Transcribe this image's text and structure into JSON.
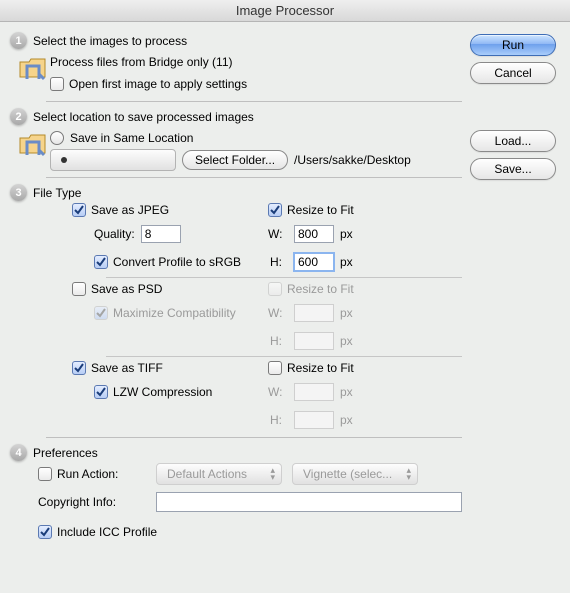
{
  "window": {
    "title": "Image Processor"
  },
  "buttons": {
    "run": "Run",
    "cancel": "Cancel",
    "load": "Load...",
    "save": "Save..."
  },
  "section1": {
    "num": "1",
    "title": "Select the images to process",
    "bridge_line": "Process files from Bridge only (11)",
    "open_first": {
      "checked": false,
      "label": "Open first image to apply settings"
    }
  },
  "section2": {
    "num": "2",
    "title": "Select location to save processed images",
    "same_location": {
      "selected": false,
      "label": "Save in Same Location"
    },
    "select_folder": {
      "selected": true,
      "button": "Select Folder...",
      "path": "/Users/sakke/Desktop"
    }
  },
  "section3": {
    "num": "3",
    "title": "File Type",
    "jpeg": {
      "save": {
        "checked": true,
        "label": "Save as JPEG"
      },
      "quality_label": "Quality:",
      "quality_value": "8",
      "convert": {
        "checked": true,
        "label": "Convert Profile to sRGB"
      },
      "resize": {
        "checked": true,
        "label": "Resize to Fit"
      },
      "w_label": "W:",
      "w_value": "800",
      "h_label": "H:",
      "h_value": "600",
      "px": "px"
    },
    "psd": {
      "save": {
        "checked": false,
        "label": "Save as PSD"
      },
      "max": {
        "checked": true,
        "label": "Maximize Compatibility"
      },
      "resize": {
        "checked": false,
        "label": "Resize to Fit"
      },
      "w_label": "W:",
      "w_value": "",
      "h_label": "H:",
      "h_value": "",
      "px": "px"
    },
    "tiff": {
      "save": {
        "checked": true,
        "label": "Save as TIFF"
      },
      "lzw": {
        "checked": true,
        "label": "LZW Compression"
      },
      "resize": {
        "checked": false,
        "label": "Resize to Fit"
      },
      "w_label": "W:",
      "w_value": "",
      "h_label": "H:",
      "h_value": "",
      "px": "px"
    }
  },
  "section4": {
    "num": "4",
    "title": "Preferences",
    "run_action": {
      "checked": false,
      "label": "Run Action:"
    },
    "action_set": "Default Actions",
    "action_name": "Vignette (selec...",
    "copyright_label": "Copyright Info:",
    "copyright_value": "",
    "include_icc": {
      "checked": true,
      "label": "Include ICC Profile"
    }
  }
}
